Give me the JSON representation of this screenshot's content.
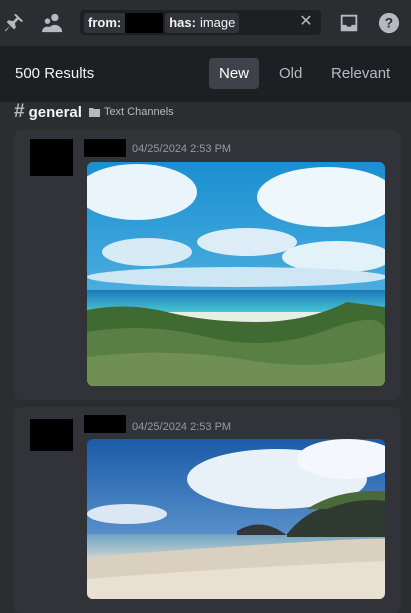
{
  "toolbar": {
    "pin_icon": "pin-icon",
    "members_icon": "members-icon",
    "inbox_icon": "inbox-icon",
    "help_icon": "help-icon"
  },
  "search": {
    "filters": [
      {
        "key": "from:",
        "value": ""
      },
      {
        "key": "has:",
        "value": "image"
      }
    ],
    "clear_icon": "close-icon"
  },
  "results": {
    "count_label": "500 Results",
    "sort_options": [
      "New",
      "Old",
      "Relevant"
    ],
    "active_sort": "New"
  },
  "channel": {
    "hash": "#",
    "name": "general",
    "category": "Text Channels"
  },
  "messages": [
    {
      "timestamp": "04/25/2024 2:53 PM",
      "attachment": "image"
    },
    {
      "timestamp": "04/25/2024 2:53 PM",
      "attachment": "image"
    }
  ],
  "colors": {
    "background": "#2b2d31",
    "card": "#313338",
    "results_bar": "#1e1f22",
    "active_tab": "#404249"
  }
}
